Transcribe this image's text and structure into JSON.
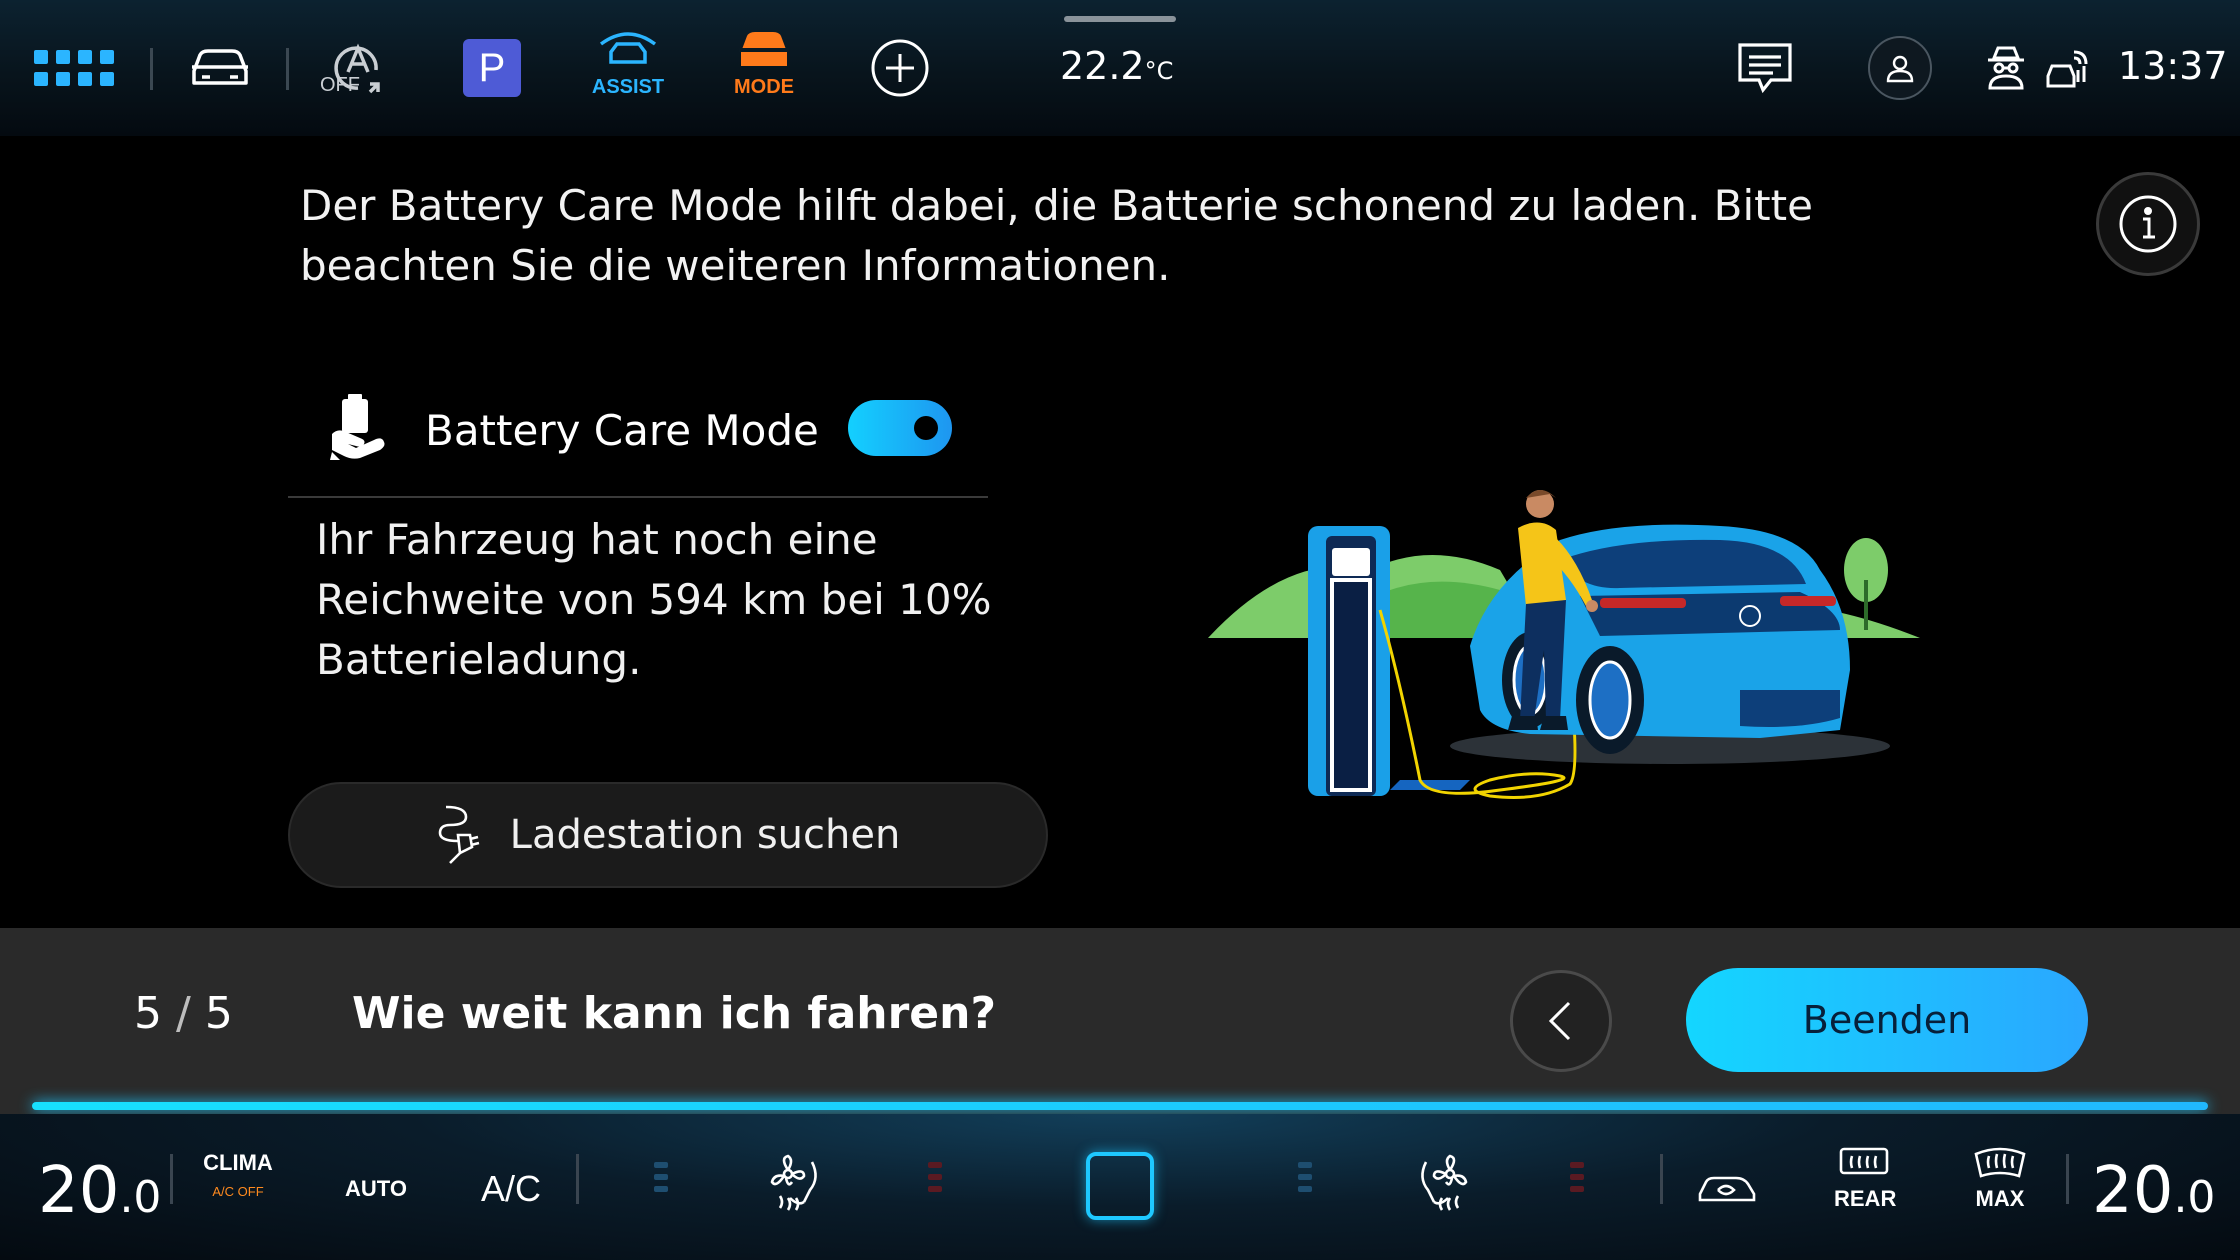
{
  "topbar": {
    "off_label": "OFF",
    "parking_label": "P",
    "assist_label": "ASSIST",
    "mode_label": "MODE",
    "temperature": "22.2",
    "temperature_unit": "°C",
    "time": "13:37",
    "accent_color": "#2bb5ff",
    "mode_color": "#ff7a1a",
    "parking_color": "#4e5bd6"
  },
  "main": {
    "intro": "Der Battery Care Mode hilft dabei, die Batterie schonend zu laden. Bitte beachten Sie die weiteren Informationen.",
    "battery_care_label": "Battery Care Mode",
    "battery_care_on": true,
    "description": "Ihr Fahrzeug hat noch eine Reichweite von 594 km bei 10% Batterieladung.",
    "search_button": "Ladestation suchen"
  },
  "stepbar": {
    "current_step": "5",
    "separator": "/",
    "total_steps": "5",
    "title": "Wie weit kann ich fahren?",
    "finish_button": "Beenden",
    "progress": 1.0
  },
  "climate": {
    "left_temp": "20",
    "left_temp_decimal": ".0",
    "clima_label": "CLIMA",
    "ac_off_label": "A/C OFF",
    "auto_label": "AUTO",
    "ac_label": "A/C",
    "rear_label": "REAR",
    "max_label": "MAX",
    "right_temp": "20",
    "right_temp_decimal": ".0"
  }
}
